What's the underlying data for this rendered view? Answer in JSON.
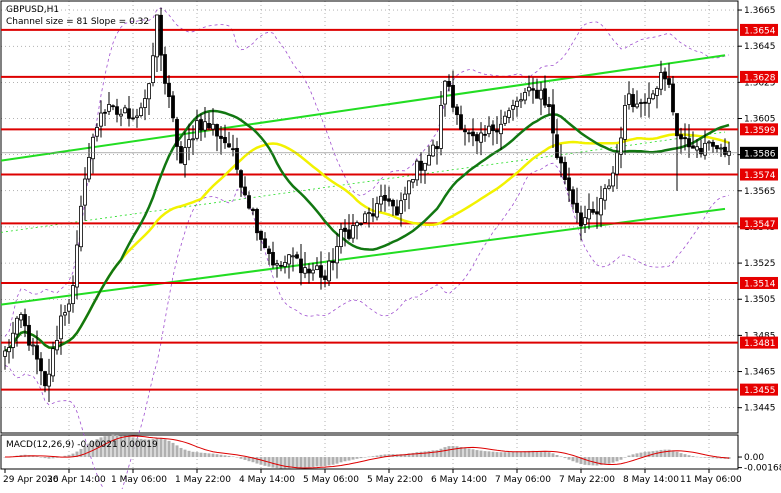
{
  "chart_data": {
    "type": "candlestick",
    "symbol_label": "GBPUSD,H1",
    "channel_label": "Channel size = 81 Slope = 0.32",
    "colors": {
      "candle": "#000000",
      "level_line": "#dd0000",
      "level_label_bg": "#e60000",
      "level_label_text": "#ffffff",
      "channel": "#22dd22",
      "ma_fast": "#117711",
      "ma_slow": "#f2f200",
      "bollinger": "#a050d0",
      "current_price_bg": "#000000",
      "grid": "#000000",
      "macd_hist": "#b0b0b0",
      "macd_signal": "#dd0000"
    },
    "price_axis": {
      "ylim": [
        1.3431,
        1.367
      ],
      "ticks": [
        "1.3665",
        "1.3645",
        "1.3625",
        "1.3605",
        "1.3585",
        "1.3565",
        "1.3545",
        "1.3525",
        "1.3505",
        "1.3485",
        "1.3465",
        "1.3445"
      ]
    },
    "levels": [
      {
        "value": 1.3654,
        "label": "1.3654"
      },
      {
        "value": 1.3628,
        "label": "1.3628"
      },
      {
        "value": 1.3599,
        "label": "1.3599"
      },
      {
        "value": 1.3574,
        "label": "1.3574"
      },
      {
        "value": 1.3547,
        "label": "1.3547"
      },
      {
        "value": 1.3514,
        "label": "1.3514"
      },
      {
        "value": 1.3481,
        "label": "1.3481"
      },
      {
        "value": 1.3455,
        "label": "1.3455"
      }
    ],
    "current_price": {
      "value": 1.3586,
      "label": "1.3586"
    },
    "time_axis": {
      "labels": [
        "29 Apr 2026",
        "30 Apr 14:00",
        "1 May 06:00",
        "1 May 22:00",
        "4 May 14:00",
        "5 May 06:00",
        "5 May 22:00",
        "6 May 14:00",
        "7 May 06:00",
        "7 May 22:00",
        "8 May 14:00",
        "11 May 06:00"
      ],
      "label_bar_index": [
        0,
        16,
        32,
        48,
        64,
        80,
        96,
        112,
        128,
        144,
        160,
        176
      ]
    },
    "channel": {
      "upper": {
        "from": [
          0,
          1.3582
        ],
        "to": [
          180,
          1.364
        ]
      },
      "lower": {
        "from": [
          0,
          1.3502
        ],
        "to": [
          180,
          1.3555
        ]
      }
    },
    "macd": {
      "label": "MACD(12,26,9) -0.00021 0.00019",
      "ticks": [
        "0.00",
        "-0.00168"
      ],
      "ylim": [
        -0.0019,
        0.0035
      ]
    },
    "anchors": [
      [
        0,
        1.3475
      ],
      [
        4,
        1.3495
      ],
      [
        8,
        1.347
      ],
      [
        10,
        1.3455
      ],
      [
        14,
        1.3495
      ],
      [
        17,
        1.351
      ],
      [
        20,
        1.3575
      ],
      [
        24,
        1.361
      ],
      [
        28,
        1.3608
      ],
      [
        33,
        1.3608
      ],
      [
        36,
        1.362
      ],
      [
        38,
        1.366
      ],
      [
        40,
        1.3625
      ],
      [
        44,
        1.358
      ],
      [
        48,
        1.3603
      ],
      [
        52,
        1.36
      ],
      [
        56,
        1.359
      ],
      [
        60,
        1.3565
      ],
      [
        64,
        1.354
      ],
      [
        68,
        1.3522
      ],
      [
        72,
        1.3528
      ],
      [
        76,
        1.352
      ],
      [
        78,
        1.3522
      ],
      [
        80,
        1.3516
      ],
      [
        84,
        1.354
      ],
      [
        88,
        1.3546
      ],
      [
        92,
        1.3553
      ],
      [
        96,
        1.3562
      ],
      [
        98,
        1.355
      ],
      [
        102,
        1.3575
      ],
      [
        104,
        1.358
      ],
      [
        106,
        1.3585
      ],
      [
        108,
        1.359
      ],
      [
        110,
        1.3628
      ],
      [
        112,
        1.3612
      ],
      [
        116,
        1.3595
      ],
      [
        118,
        1.359
      ],
      [
        122,
        1.36
      ],
      [
        126,
        1.3608
      ],
      [
        130,
        1.3618
      ],
      [
        134,
        1.362
      ],
      [
        136,
        1.361
      ],
      [
        138,
        1.3585
      ],
      [
        142,
        1.356
      ],
      [
        144,
        1.3549
      ],
      [
        148,
        1.3552
      ],
      [
        152,
        1.3575
      ],
      [
        156,
        1.362
      ],
      [
        158,
        1.3612
      ],
      [
        162,
        1.3622
      ],
      [
        164,
        1.3628
      ],
      [
        166,
        1.3622
      ],
      [
        168,
        1.3598
      ],
      [
        170,
        1.359
      ],
      [
        172,
        1.359
      ],
      [
        174,
        1.3586
      ],
      [
        176,
        1.3593
      ],
      [
        178,
        1.3588
      ],
      [
        180,
        1.3586
      ]
    ]
  }
}
